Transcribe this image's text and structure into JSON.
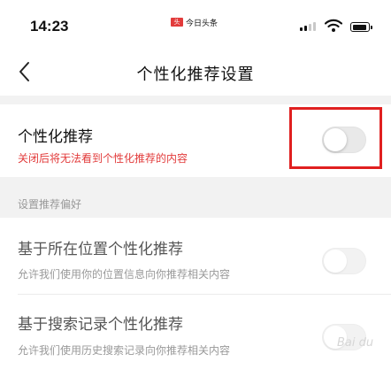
{
  "status_bar": {
    "time": "14:23",
    "app_label": "今日头条"
  },
  "nav": {
    "title": "个性化推荐设置"
  },
  "main_setting": {
    "title": "个性化推荐",
    "subtitle": "关闭后将无法看到个性化推荐的内容",
    "toggle_on": false
  },
  "group": {
    "label": "设置推荐偏好",
    "items": [
      {
        "title": "基于所在位置个性化推荐",
        "subtitle": "允许我们使用你的位置信息向你推荐相关内容",
        "toggle_on": false
      },
      {
        "title": "基于搜索记录个性化推荐",
        "subtitle": "允许我们使用历史搜索记录向你推荐相关内容",
        "toggle_on": false
      }
    ]
  },
  "watermark": "Bai du"
}
